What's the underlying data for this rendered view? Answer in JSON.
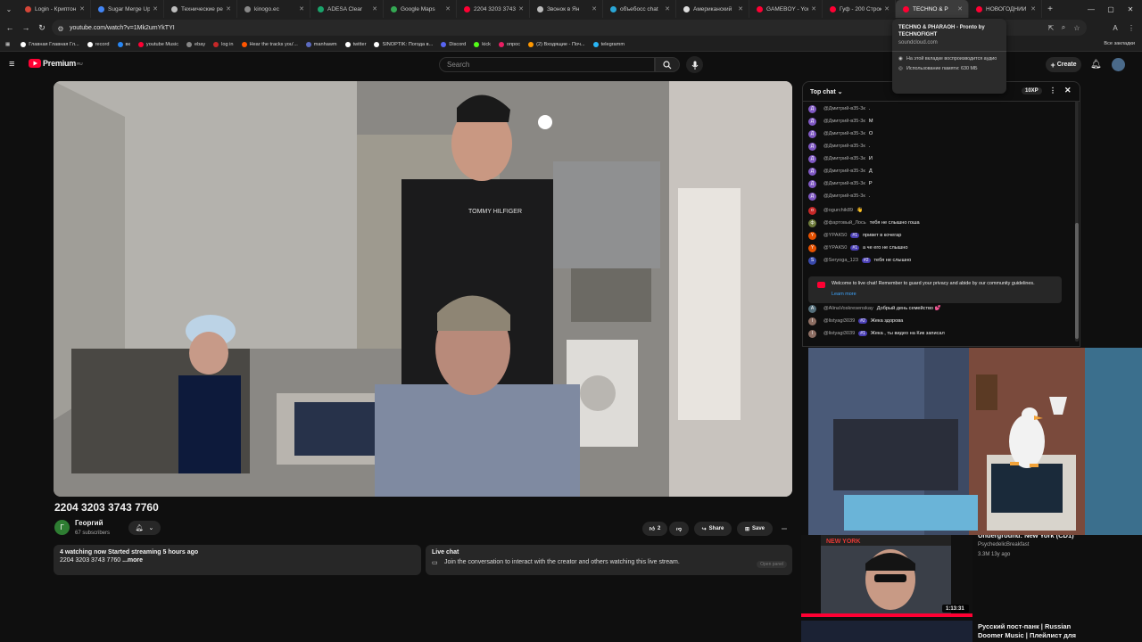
{
  "browser": {
    "tabs": [
      {
        "label": "Login - Криптон",
        "color": "#d44638"
      },
      {
        "label": "Sugar Merge Up",
        "color": "#4285f4"
      },
      {
        "label": "Технические ре",
        "color": "#bdbdbd"
      },
      {
        "label": "kinogo.ec",
        "color": "#888888"
      },
      {
        "label": "ADESA Clear",
        "color": "#1aa36b"
      },
      {
        "label": "Google Maps",
        "color": "#34a853"
      },
      {
        "label": "2204 3203 3743",
        "color": "#ff0033"
      },
      {
        "label": "Звонок в Ян",
        "color": "#bbbbbb"
      },
      {
        "label": "объебосс chat",
        "color": "#2aa6d6"
      },
      {
        "label": "Американский",
        "color": "#dddddd"
      },
      {
        "label": "GAMEBOY - You",
        "color": "#ff0033"
      },
      {
        "label": "Гуф - 200 Строк",
        "color": "#ff0033"
      },
      {
        "label": "TECHNO & P",
        "color": "#ff0033",
        "active": true
      },
      {
        "label": "НОВОГОДНИЙ",
        "color": "#ff0033"
      }
    ],
    "url": "youtube.com/watch?v=1Mk2umYkTYI",
    "bookmarks": [
      {
        "label": "Главная Главная Гл...",
        "color": "#ffffff"
      },
      {
        "label": "record",
        "color": "#ffffff"
      },
      {
        "label": "вк",
        "color": "#2787f5"
      },
      {
        "label": "youtube Music",
        "color": "#ff0033"
      },
      {
        "label": "ebay",
        "color": "#888888"
      },
      {
        "label": "log in",
        "color": "#c62828"
      },
      {
        "label": "Hear the tracks you'...",
        "color": "#ff5500"
      },
      {
        "label": "manhawm",
        "color": "#5c6bc0"
      },
      {
        "label": "twitter",
        "color": "#ffffff"
      },
      {
        "label": "SINOPTIK: Погода в...",
        "color": "#ffffff"
      },
      {
        "label": "Discord",
        "color": "#5865f2"
      },
      {
        "label": "kick",
        "color": "#53fc18"
      },
      {
        "label": "опрос",
        "color": "#e91e63"
      },
      {
        "label": "(2) Входящие - Поч...",
        "color": "#ff9800"
      },
      {
        "label": "telegramm",
        "color": "#29b6f6"
      }
    ],
    "all_bookmarks": "Все закладки"
  },
  "popup": {
    "title": "TECHNO & PHARAOH - Pronto by TECHNOFIGHT",
    "domain": "soundcloud.com",
    "line1": "На этой вкладке воспроизводится аудио",
    "line2": "Использование памяти: 630 МБ"
  },
  "youtube": {
    "logo_text": "Premium",
    "logo_region": "RU",
    "search_placeholder": "Search",
    "create_label": "Create"
  },
  "video": {
    "title": "2204 3203 3743 7760",
    "channel": "Георгий",
    "channel_initial": "Г",
    "subscribers": "67 subscribers",
    "likes": "2",
    "share_label": "Share",
    "save_label": "Save",
    "description_line1": "4 watching now  Started streaming 5 hours ago",
    "description_line2": "2204 3203 3743 7760",
    "more_label": "...more",
    "tshirt_text": "TOMMY HILFIGER"
  },
  "live_chat_card": {
    "title": "Live chat",
    "description": "Join the conversation to interact with the creator and others watching this live stream.",
    "open_label": "Open panel"
  },
  "chat": {
    "title": "Top chat",
    "boost": "10XP",
    "messages": [
      {
        "author": "@Дмитрий-в35-3к",
        "text": ".",
        "avatar": "Д",
        "color": "#7e57c2"
      },
      {
        "author": "@Дмитрий-в35-3к",
        "text": "М",
        "avatar": "Д",
        "color": "#7e57c2"
      },
      {
        "author": "@Дмитрий-в35-3к",
        "text": "О",
        "avatar": "Д",
        "color": "#7e57c2"
      },
      {
        "author": "@Дмитрий-в35-3к",
        "text": ".",
        "avatar": "Д",
        "color": "#7e57c2"
      },
      {
        "author": "@Дмитрий-в35-3к",
        "text": "И",
        "avatar": "Д",
        "color": "#7e57c2"
      },
      {
        "author": "@Дмитрий-в35-3к",
        "text": "Д",
        "avatar": "Д",
        "color": "#7e57c2"
      },
      {
        "author": "@Дмитрий-в35-3к",
        "text": "Р",
        "avatar": "Д",
        "color": "#7e57c2"
      },
      {
        "author": "@Дмитрий-в35-3к",
        "text": ".",
        "avatar": "Д",
        "color": "#7e57c2"
      },
      {
        "author": "@ogurchik89",
        "text": "👋",
        "avatar": "o",
        "color": "#c62828"
      },
      {
        "author": "@фартовый_Лось",
        "text": "тебя не слышно гоша",
        "avatar": "ф",
        "color": "#6d7a3a"
      },
      {
        "author": "@YPAK50",
        "badge": "#1",
        "text": "привет в кочегар",
        "avatar": "Y",
        "color": "#e65100"
      },
      {
        "author": "@YPAK50",
        "badge": "#1",
        "text": "а че его не слышно",
        "avatar": "Y",
        "color": "#e65100"
      },
      {
        "author": "@Seryoga_123",
        "badge": "#2",
        "text": "тебя не слышно",
        "avatar": "S",
        "color": "#3949ab"
      },
      {
        "author": "@AlinaVoskresenskay",
        "text": "Добрый день семейство 💕",
        "avatar": "A",
        "color": "#546e7a"
      },
      {
        "author": "@listyagi3039",
        "badge": "#2",
        "text": "Жека здорова",
        "avatar": "l",
        "color": "#8d6e63"
      },
      {
        "author": "@listyagi3039",
        "badge": "#1",
        "text": "Жека , ты видео на Кик записал",
        "avatar": "l",
        "color": "#8d6e63"
      }
    ],
    "welcome_text": "Welcome to live chat! Remember to guard your privacy and abide by our community guidelines.",
    "learn_more": "Learn more"
  },
  "recommendations": [
    {
      "title": "Underground: New York (CD1)",
      "channel": "PsychedelicBreakfast",
      "meta": "3.3M  13y ago",
      "duration": "1:13:31",
      "thumb_text": "NEW YORK"
    },
    {
      "title": "Русский пост-панк | Russian Doomer Music | Плейлист для"
    }
  ],
  "colors": {
    "background": "#0f0f0f",
    "youtube_red": "#ff0033",
    "chat_badge": "#4a3fb5"
  }
}
